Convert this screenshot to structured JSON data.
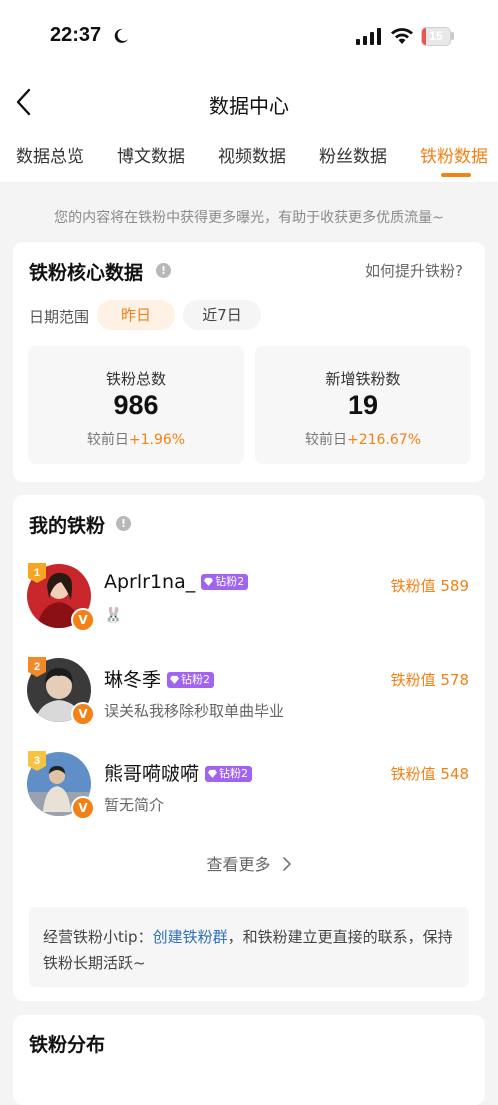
{
  "status_bar": {
    "time": "22:37",
    "battery_level": "15",
    "battery_fraction": 0.15
  },
  "header": {
    "title": "数据中心"
  },
  "tabs": [
    {
      "label": "数据总览",
      "active": false
    },
    {
      "label": "博文数据",
      "active": false
    },
    {
      "label": "视频数据",
      "active": false
    },
    {
      "label": "粉丝数据",
      "active": false
    },
    {
      "label": "铁粉数据",
      "active": true
    }
  ],
  "hint": "您的内容将在铁粉中获得更多曝光，有助于收获更多优质流量~",
  "core": {
    "title": "铁粉核心数据",
    "how_link": "如何提升铁粉?",
    "range_label": "日期范围",
    "range_options": [
      "昨日",
      "近7日"
    ],
    "stats": [
      {
        "label": "铁粉总数",
        "value": "986",
        "compare_label": "较前日",
        "compare_value": "+1.96%"
      },
      {
        "label": "新增铁粉数",
        "value": "19",
        "compare_label": "较前日",
        "compare_value": "+216.67%"
      }
    ]
  },
  "my_fans": {
    "title": "我的铁粉",
    "items": [
      {
        "rank": "1",
        "name": "Aprlr1na_",
        "badge": "钻粉2",
        "desc": "🐰",
        "score_label": "铁粉值",
        "score": "589",
        "rank_color": "#f5a623",
        "avatar_color": "#c8262b",
        "verified": "V"
      },
      {
        "rank": "2",
        "name": "琳冬季",
        "badge": "钻粉2",
        "desc": "误关私我移除秒取单曲毕业",
        "score_label": "铁粉值",
        "score": "578",
        "rank_color": "#f28a2a",
        "avatar_color": "#3a3a3a",
        "verified": "V"
      },
      {
        "rank": "3",
        "name": "熊哥嗬啵嗬",
        "badge": "钻粉2",
        "desc": "暂无简介",
        "score_label": "铁粉值",
        "score": "548",
        "rank_color": "#f6c343",
        "avatar_color": "#5f8fc6",
        "verified": "V"
      }
    ],
    "see_more": "查看更多",
    "tip_prefix": "经营铁粉小tip：",
    "tip_link": "创建铁粉群",
    "tip_suffix": "，和铁粉建立更直接的联系，保持铁粉长期活跃~"
  },
  "distribution": {
    "title": "铁粉分布"
  },
  "colors": {
    "accent": "#f28216",
    "badge": "#a064f0",
    "link": "#2f6fc4"
  },
  "icons": [
    "back-arrow-icon",
    "info-icon",
    "chevron-right-icon",
    "diamond-icon",
    "moon-icon",
    "signal-icon",
    "wifi-icon",
    "battery-icon"
  ]
}
